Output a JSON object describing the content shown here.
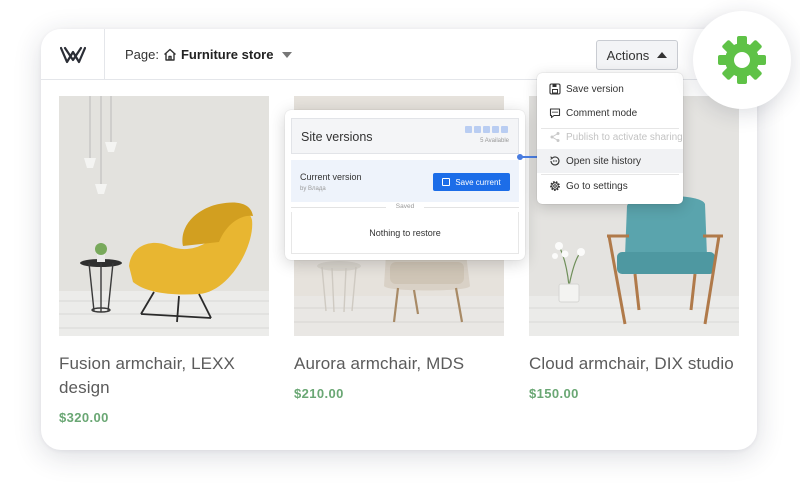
{
  "topbar": {
    "page_prefix": "Page:",
    "page_name": "Furniture store",
    "actions_label": "Actions"
  },
  "products": [
    {
      "name": "Fusion armchair, LEXX design",
      "price": "$320.00"
    },
    {
      "name": "Aurora armchair, MDS",
      "price": "$210.00"
    },
    {
      "name": "Cloud armchair, DIX studio",
      "price": "$150.00"
    }
  ],
  "versions": {
    "title": "Site versions",
    "available": "5 Available",
    "current_label": "Current version",
    "current_by": "by Влада",
    "save_button": "Save current",
    "saved_divider": "Saved",
    "empty_text": "Nothing to restore"
  },
  "menu": {
    "items": [
      {
        "label": "Save version",
        "icon": "save-icon",
        "enabled": true
      },
      {
        "label": "Comment mode",
        "icon": "comment-icon",
        "enabled": true
      },
      {
        "label": "Publish to activate sharing",
        "icon": "share-icon",
        "enabled": false
      },
      {
        "label": "Open site history",
        "icon": "history-icon",
        "enabled": true
      },
      {
        "label": "Go to settings",
        "icon": "gear-icon",
        "enabled": true
      }
    ]
  },
  "colors": {
    "accent_blue": "#1c6de8",
    "price_green": "#6aa774",
    "gear_green": "#5fc247"
  }
}
